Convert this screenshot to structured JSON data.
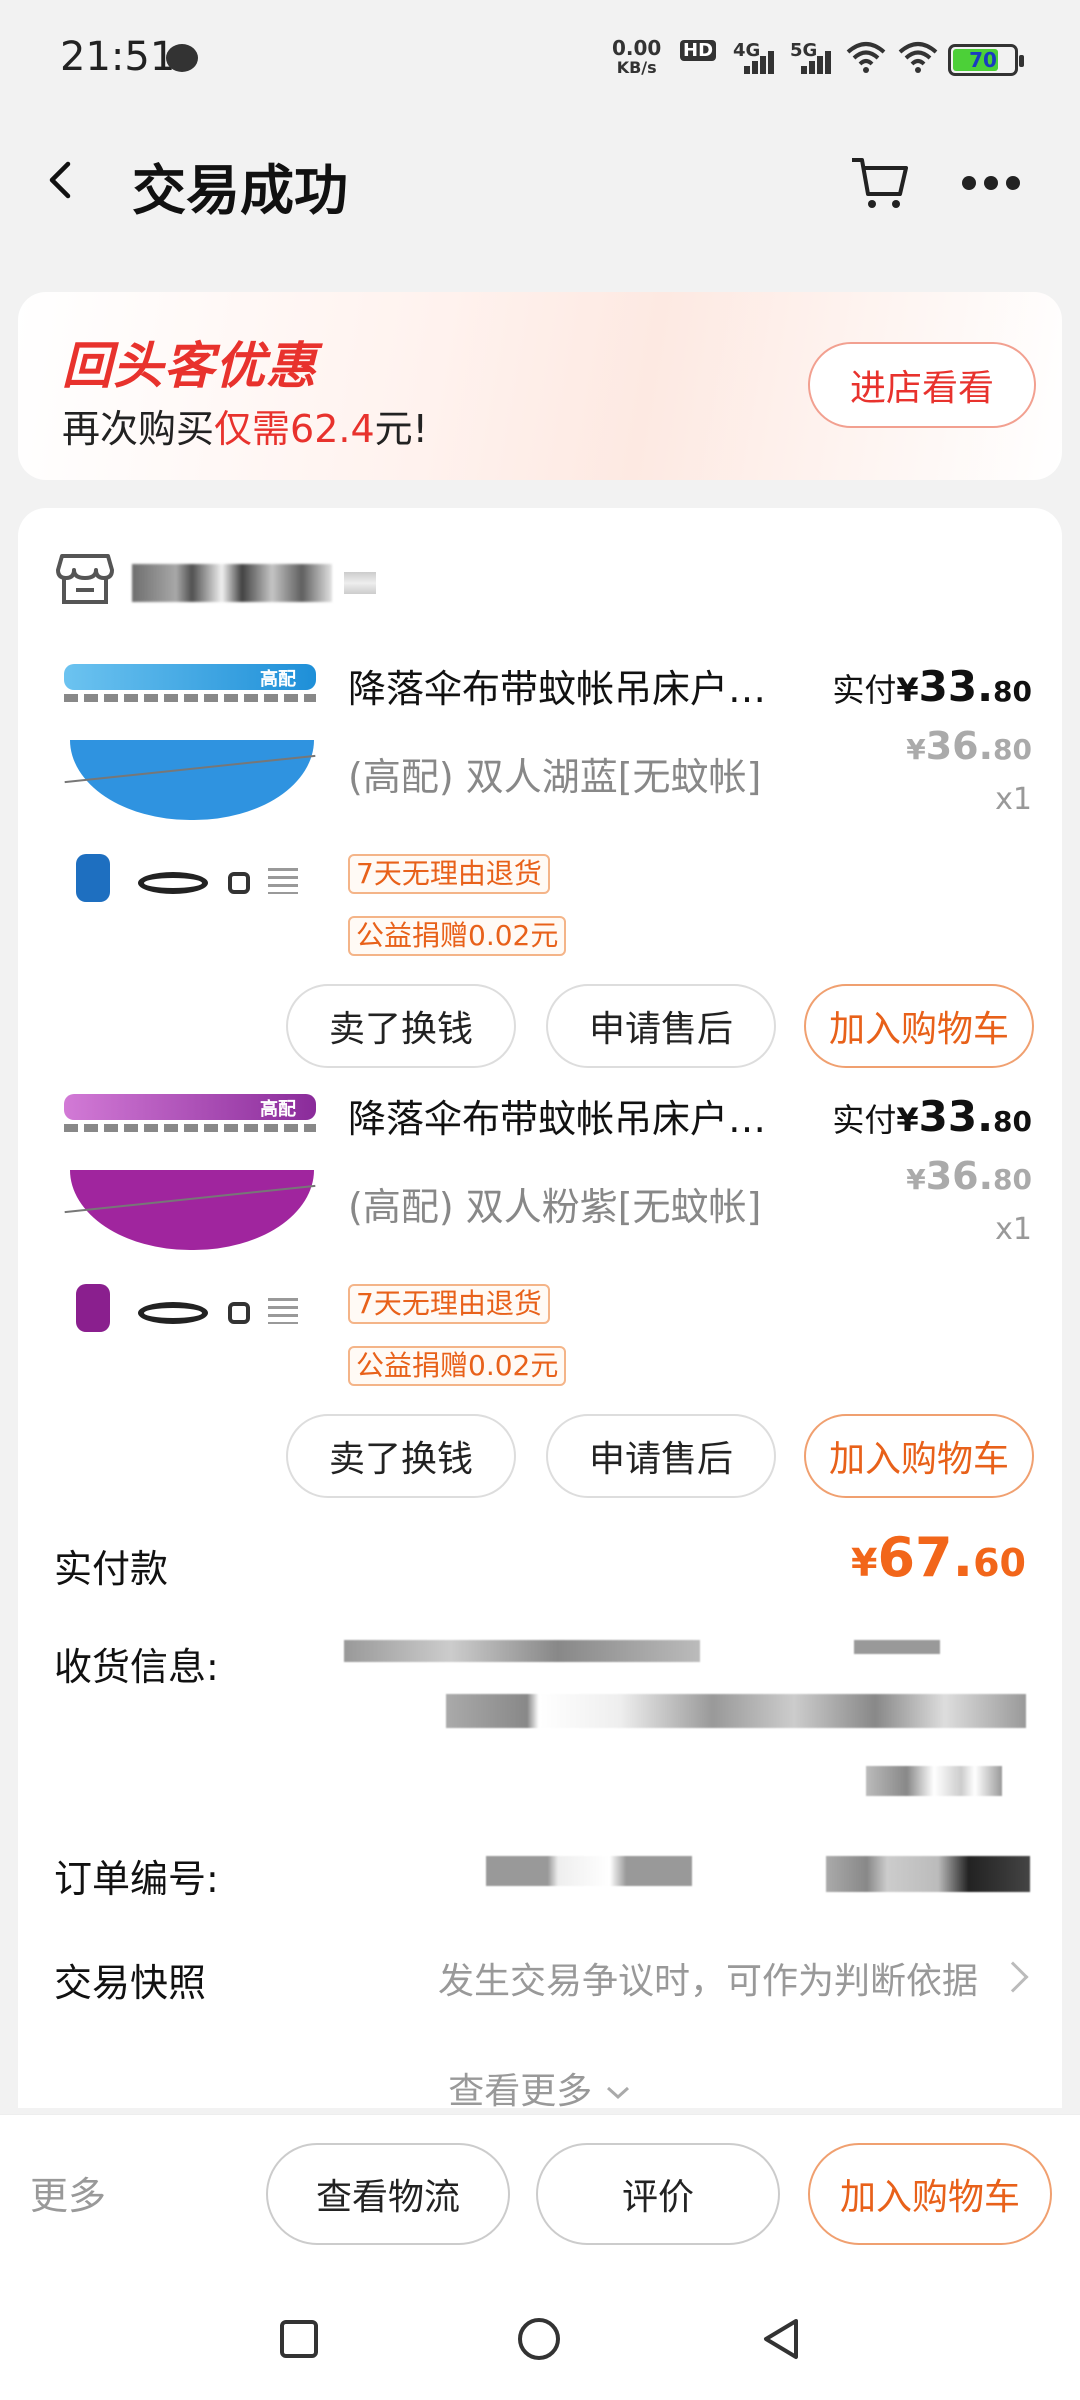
{
  "status_bar": {
    "time": "21:51",
    "net_speed_value": "0.00",
    "net_speed_unit": "KB/s",
    "hd_label": "HD",
    "net_4g": "4G",
    "net_5g": "5G",
    "battery": "70"
  },
  "nav": {
    "title": "交易成功"
  },
  "promo": {
    "logo": "回头客优惠",
    "text_prefix": "再次购买",
    "text_highlight": "仅需62.4",
    "text_suffix": "元!",
    "button": "进店看看"
  },
  "items": [
    {
      "title": "降落伞布带蚊帐吊床户…",
      "sku": "(高配) 双人湖蓝[无蚊帐]",
      "tags": [
        "7天无理由退货",
        "公益捐赠0.02元"
      ],
      "paid_label": "实付",
      "paid_currency": "¥",
      "paid_int": "33.",
      "paid_dec": "80",
      "orig_currency": "¥",
      "orig_int": "36.",
      "orig_dec": "80",
      "qty": "x1",
      "thumb_badge": "高配",
      "thumb_color": "#2f93e0",
      "buttons": [
        "卖了换钱",
        "申请售后",
        "加入购物车"
      ]
    },
    {
      "title": "降落伞布带蚊帐吊床户…",
      "sku": "(高配) 双人粉紫[无蚊帐]",
      "tags": [
        "7天无理由退货",
        "公益捐赠0.02元"
      ],
      "paid_label": "实付",
      "paid_currency": "¥",
      "paid_int": "33.",
      "paid_dec": "80",
      "orig_currency": "¥",
      "orig_int": "36.",
      "orig_dec": "80",
      "qty": "x1",
      "thumb_badge": "高配",
      "thumb_color": "#a0259e",
      "buttons": [
        "卖了换钱",
        "申请售后",
        "加入购物车"
      ]
    }
  ],
  "summary": {
    "total_label": "实付款",
    "total_currency": "¥",
    "total_int": "67.",
    "total_dec": "60",
    "address_label": "收货信息:",
    "order_no_label": "订单编号:",
    "snapshot_label": "交易快照",
    "snapshot_hint": "发生交易争议时，可作为判断依据",
    "see_more": "查看更多"
  },
  "bottom_bar": {
    "more": "更多",
    "buttons": [
      "查看物流",
      "评价",
      "加入购物车"
    ]
  },
  "colors": {
    "accent_orange": "#e8611a",
    "price_orange": "#f2661a",
    "promo_red": "#e8322d"
  }
}
